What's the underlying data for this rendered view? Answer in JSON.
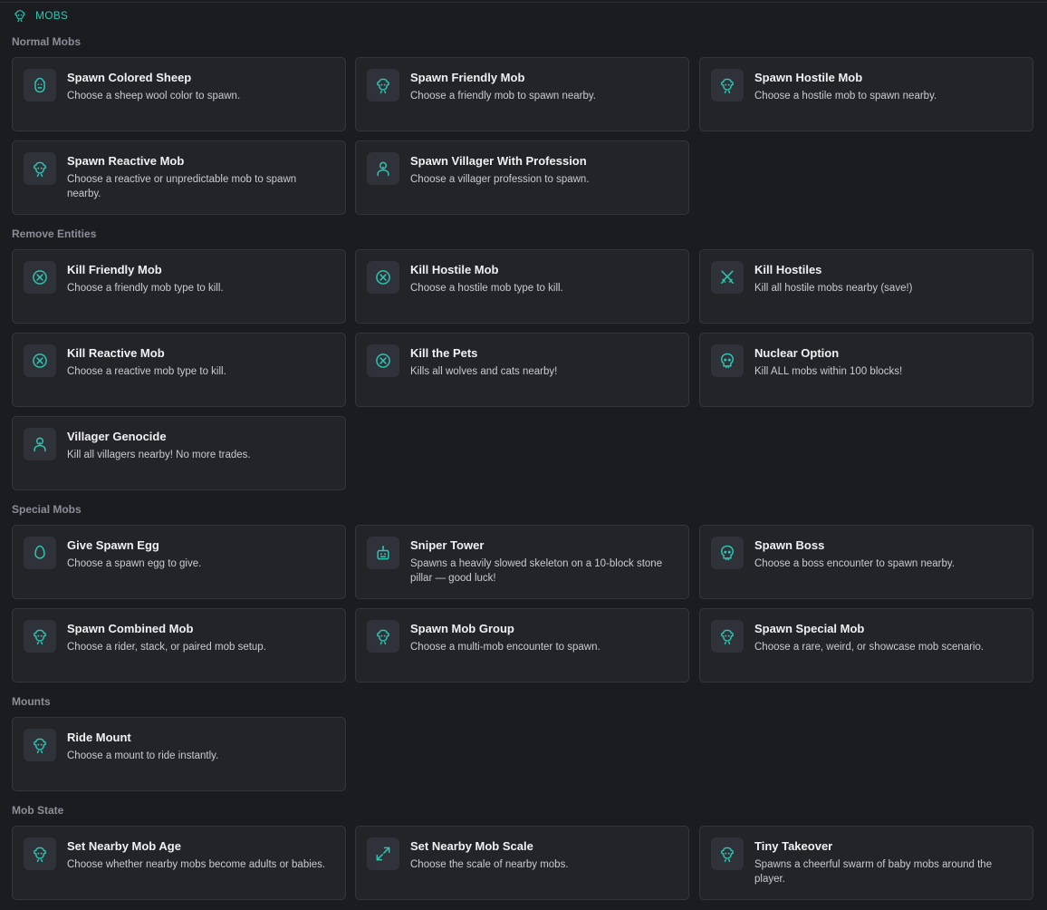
{
  "header": {
    "title": "MOBS",
    "icon": "mob-icon"
  },
  "colors": {
    "accent": "#2ec4b0",
    "card_bg": "#232428",
    "page_bg": "#1b1c20"
  },
  "sections": [
    {
      "title": "Normal Mobs",
      "cards": [
        {
          "title": "Spawn Colored Sheep",
          "desc": "Choose a sheep wool color to spawn.",
          "icon": "sheep-icon"
        },
        {
          "title": "Spawn Friendly Mob",
          "desc": "Choose a friendly mob to spawn nearby.",
          "icon": "mob-icon"
        },
        {
          "title": "Spawn Hostile Mob",
          "desc": "Choose a hostile mob to spawn nearby.",
          "icon": "mob-icon"
        },
        {
          "title": "Spawn Reactive Mob",
          "desc": "Choose a reactive or unpredictable mob to spawn nearby.",
          "icon": "mob-icon"
        },
        {
          "title": "Spawn Villager With Profession",
          "desc": "Choose a villager profession to spawn.",
          "icon": "villager-icon"
        }
      ]
    },
    {
      "title": "Remove Entities",
      "cards": [
        {
          "title": "Kill Friendly Mob",
          "desc": "Choose a friendly mob type to kill.",
          "icon": "circle-x-icon"
        },
        {
          "title": "Kill Hostile Mob",
          "desc": "Choose a hostile mob type to kill.",
          "icon": "circle-x-icon"
        },
        {
          "title": "Kill Hostiles",
          "desc": "Kill all hostile mobs nearby (save!)",
          "icon": "crossed-swords-icon"
        },
        {
          "title": "Kill Reactive Mob",
          "desc": "Choose a reactive mob type to kill.",
          "icon": "circle-x-icon"
        },
        {
          "title": "Kill the Pets",
          "desc": "Kills all wolves and cats nearby!",
          "icon": "circle-x-icon"
        },
        {
          "title": "Nuclear Option",
          "desc": "Kill ALL mobs within 100 blocks!",
          "icon": "skull-icon"
        },
        {
          "title": "Villager Genocide",
          "desc": "Kill all villagers nearby! No more trades.",
          "icon": "villager-icon"
        }
      ]
    },
    {
      "title": "Special Mobs",
      "cards": [
        {
          "title": "Give Spawn Egg",
          "desc": "Choose a spawn egg to give.",
          "icon": "egg-icon"
        },
        {
          "title": "Sniper Tower",
          "desc": "Spawns a heavily slowed skeleton on a 10-block stone pillar — good luck!",
          "icon": "robot-icon"
        },
        {
          "title": "Spawn Boss",
          "desc": "Choose a boss encounter to spawn nearby.",
          "icon": "skull-icon"
        },
        {
          "title": "Spawn Combined Mob",
          "desc": "Choose a rider, stack, or paired mob setup.",
          "icon": "mob-icon"
        },
        {
          "title": "Spawn Mob Group",
          "desc": "Choose a multi-mob encounter to spawn.",
          "icon": "mob-icon"
        },
        {
          "title": "Spawn Special Mob",
          "desc": "Choose a rare, weird, or showcase mob scenario.",
          "icon": "mob-icon"
        }
      ]
    },
    {
      "title": "Mounts",
      "cards": [
        {
          "title": "Ride Mount",
          "desc": "Choose a mount to ride instantly.",
          "icon": "mob-icon"
        }
      ]
    },
    {
      "title": "Mob State",
      "cards": [
        {
          "title": "Set Nearby Mob Age",
          "desc": "Choose whether nearby mobs become adults or babies.",
          "icon": "mob-icon"
        },
        {
          "title": "Set Nearby Mob Scale",
          "desc": "Choose the scale of nearby mobs.",
          "icon": "expand-icon"
        },
        {
          "title": "Tiny Takeover",
          "desc": "Spawns a cheerful swarm of baby mobs around the player.",
          "icon": "mob-icon"
        }
      ]
    }
  ]
}
